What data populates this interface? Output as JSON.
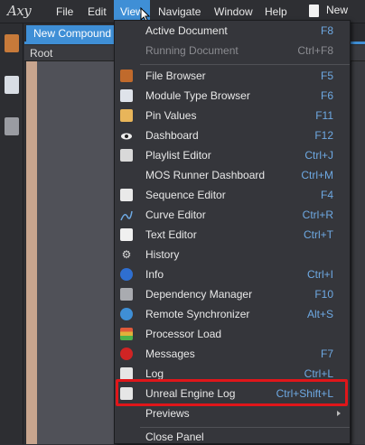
{
  "app": {
    "logo": "Axy"
  },
  "menubar": {
    "items": [
      {
        "label": "File"
      },
      {
        "label": "Edit"
      },
      {
        "label": "View"
      },
      {
        "label": "Navigate"
      },
      {
        "label": "Window"
      },
      {
        "label": "Help"
      }
    ],
    "new_label": "New"
  },
  "tabs": {
    "active": "New Compound"
  },
  "tree": {
    "root": "Root"
  },
  "view_menu": {
    "items": [
      {
        "label": "Active Document",
        "shortcut": "F8",
        "icon": "none",
        "disabled": false
      },
      {
        "label": "Running Document",
        "shortcut": "Ctrl+F8",
        "icon": "none",
        "disabled": true
      },
      {
        "label": "File Browser",
        "shortcut": "F5",
        "icon": "file-browser-icon",
        "disabled": false
      },
      {
        "label": "Module Type Browser",
        "shortcut": "F6",
        "icon": "module-type-icon",
        "disabled": false
      },
      {
        "label": "Pin Values",
        "shortcut": "F11",
        "icon": "pin-values-icon",
        "disabled": false
      },
      {
        "label": "Dashboard",
        "shortcut": "F12",
        "icon": "eye-icon",
        "disabled": false
      },
      {
        "label": "Playlist Editor",
        "shortcut": "Ctrl+J",
        "icon": "playlist-icon",
        "disabled": false
      },
      {
        "label": "MOS Runner Dashboard",
        "shortcut": "Ctrl+M",
        "icon": "none",
        "disabled": false
      },
      {
        "label": "Sequence Editor",
        "shortcut": "F4",
        "icon": "clapper-icon",
        "disabled": false
      },
      {
        "label": "Curve Editor",
        "shortcut": "Ctrl+R",
        "icon": "curve-icon",
        "disabled": false
      },
      {
        "label": "Text Editor",
        "shortcut": "Ctrl+T",
        "icon": "text-editor-icon",
        "disabled": false
      },
      {
        "label": "History",
        "shortcut": "",
        "icon": "gear-icon",
        "disabled": false
      },
      {
        "label": "Info",
        "shortcut": "Ctrl+I",
        "icon": "info-icon",
        "disabled": false
      },
      {
        "label": "Dependency Manager",
        "shortcut": "F10",
        "icon": "dependency-icon",
        "disabled": false
      },
      {
        "label": "Remote Synchronizer",
        "shortcut": "Alt+S",
        "icon": "sync-icon",
        "disabled": false
      },
      {
        "label": "Processor Load",
        "shortcut": "",
        "icon": "processor-load-icon",
        "disabled": false
      },
      {
        "label": "Messages",
        "shortcut": "F7",
        "icon": "warning-icon",
        "disabled": false
      },
      {
        "label": "Log",
        "shortcut": "Ctrl+L",
        "icon": "log-icon",
        "disabled": false
      },
      {
        "label": "Unreal Engine Log",
        "shortcut": "Ctrl+Shift+L",
        "icon": "log-icon",
        "disabled": false
      },
      {
        "label": "Previews",
        "shortcut": "",
        "icon": "none",
        "disabled": false
      },
      {
        "label": "Close Panel",
        "shortcut": "",
        "icon": "none",
        "disabled": false
      }
    ]
  },
  "colors": {
    "accent": "#3f8fd6",
    "highlight_box": "#e0161a",
    "shortcut_text": "#6ea9e3"
  }
}
